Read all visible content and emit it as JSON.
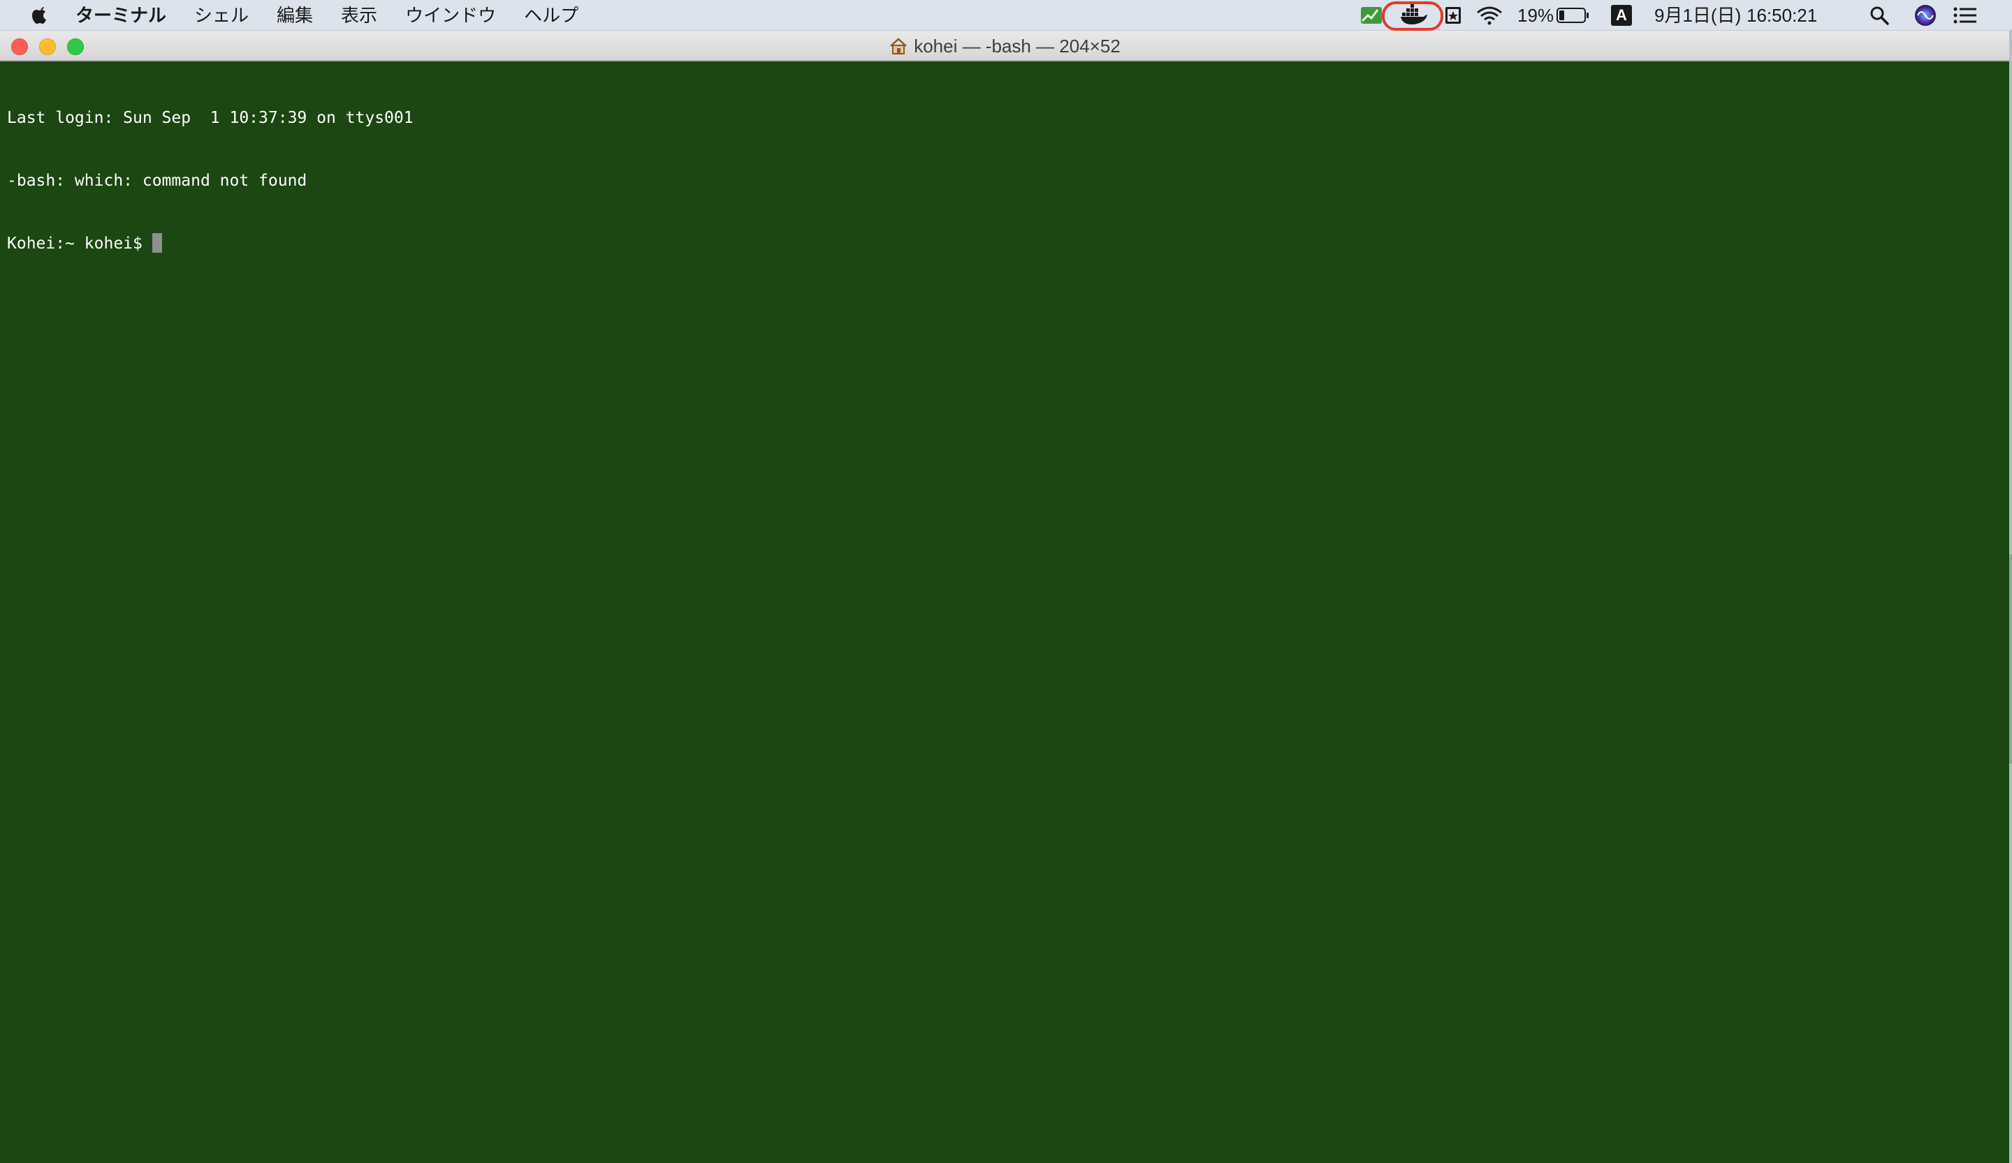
{
  "menubar": {
    "app_name": "ターミナル",
    "items": [
      "シェル",
      "編集",
      "表示",
      "ウインドウ",
      "ヘルプ"
    ],
    "status": {
      "battery_percent": "19%",
      "input_method": "A",
      "date": "9月1日(日)",
      "time": "16:50:21"
    },
    "icons": [
      "apple-icon",
      "activity-icon",
      "docker-icon",
      "script-icon",
      "wifi-icon",
      "battery-icon",
      "input-method-icon",
      "search-icon",
      "siri-icon",
      "notification-center-icon"
    ],
    "highlight_color": "#e43a2b"
  },
  "window": {
    "title": "kohei — -bash — 204×52",
    "background": "#1c4612",
    "lines": [
      "Last login: Sun Sep  1 10:37:39 on ttys001",
      "-bash: which: command not found",
      "Kohei:~ kohei$ "
    ]
  }
}
